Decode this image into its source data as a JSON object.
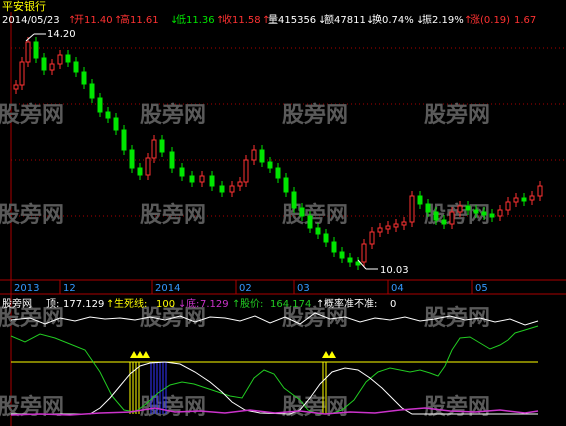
{
  "stock": {
    "name": "平安银行"
  },
  "quote": {
    "date": "2014/05/23",
    "open_label": "开",
    "open": "11.40",
    "high_label": "高",
    "high": "11.61",
    "low_label": "低",
    "low": "11.36",
    "close_label": "收",
    "close": "11.58",
    "volume_label": "量",
    "volume": "415356",
    "amount_label": "额",
    "amount": "47811",
    "turnover_label": "换",
    "turnover": "0.74%",
    "amplitude_label": "振",
    "amplitude": "2.19%",
    "change_label": "涨",
    "change": "(0.19)",
    "change_pct": "1.67"
  },
  "price_chart": {
    "high_marker": "14.20",
    "low_marker": "10.03",
    "watermark": "股旁网",
    "date_axis": [
      "2013",
      "12",
      "2014",
      "02",
      "03",
      "04",
      "05"
    ],
    "up_color": "#ff3232",
    "down_color": "#00e600"
  },
  "indicator": {
    "name": "股旁网",
    "top_label": "顶:",
    "top_value": "177.129",
    "line_label": "生死线:",
    "line_value": "100",
    "bottom_label": "底:",
    "bottom_value": "7.129",
    "price_label": "股价:",
    "price_value": "164.174",
    "prob_label": "概率准不准:",
    "prob_value": "0"
  },
  "colors": {
    "axis": "#aa0000",
    "grid": "#aa0000",
    "white_line": "#ffffff",
    "green_line": "#22cc22",
    "purple_line": "#cc33cc",
    "yellow_line": "#ffff00",
    "blue_bar": "#3333ff"
  }
}
